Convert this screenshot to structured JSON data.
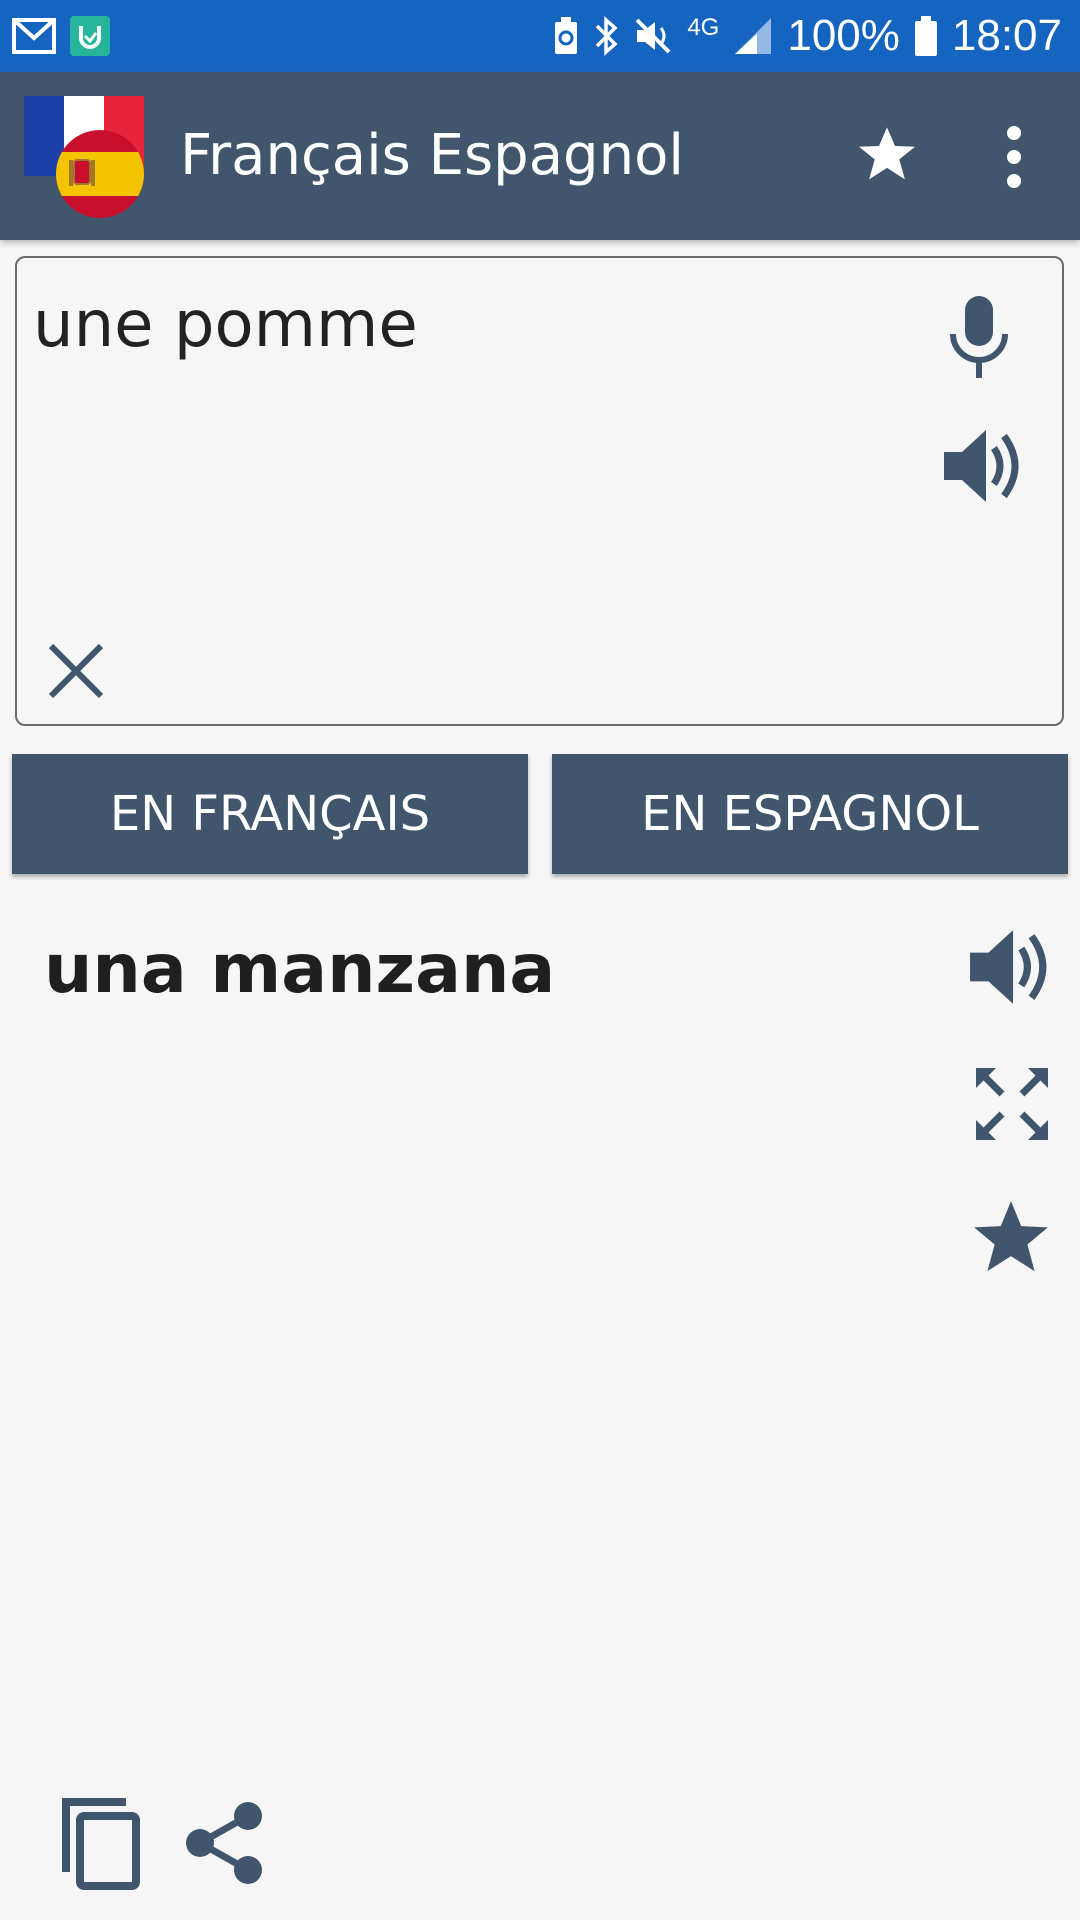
{
  "status_bar": {
    "network": "4G",
    "battery": "100%",
    "time": "18:07"
  },
  "app_bar": {
    "title": "Français Espagnol"
  },
  "input": {
    "text": "une pomme"
  },
  "buttons": {
    "to_french": "EN FRANÇAIS",
    "to_spanish": "EN ESPAGNOL"
  },
  "result": {
    "text": "una manzana"
  },
  "colors": {
    "status_bar": "#1565c0",
    "primary": "#41566d",
    "background": "#f6f6f7"
  },
  "icons": [
    "mail-icon",
    "mi-icon",
    "battery-saver-icon",
    "bluetooth-icon",
    "mute-icon",
    "signal-icon",
    "battery-icon",
    "flags-icon",
    "star-icon",
    "more-vert-icon",
    "mic-icon",
    "speaker-icon",
    "close-icon",
    "fullscreen-icon",
    "copy-icon",
    "share-icon"
  ]
}
